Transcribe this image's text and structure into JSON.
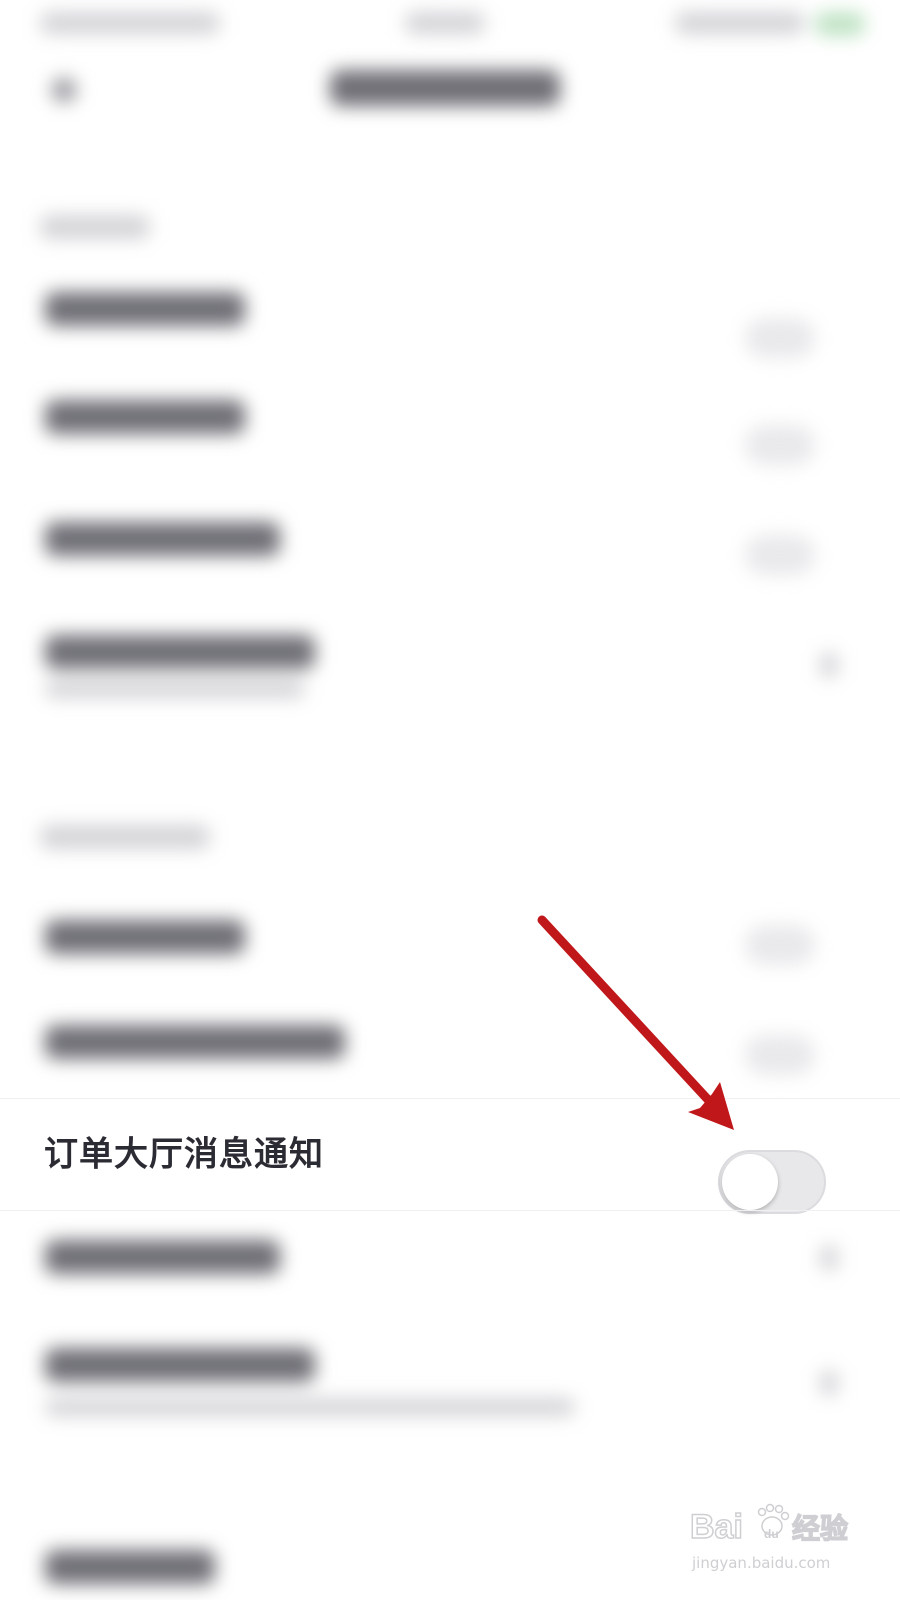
{
  "settings": {
    "order_hall_row": {
      "label": "订单大厅消息通知",
      "toggle_on": false
    }
  },
  "annotation": {
    "arrow_color": "#c0171a",
    "arrow_target": "order-hall-toggle"
  },
  "watermark": {
    "brand_left": "Bai",
    "brand_right": "经验",
    "url": "jingyan.baidu.com",
    "icon": "paw-icon"
  },
  "colors": {
    "background": "#ffffff",
    "label_text": "#2b2b33",
    "toggle_track_off": "#e8e8ea",
    "toggle_knob": "#ffffff"
  }
}
